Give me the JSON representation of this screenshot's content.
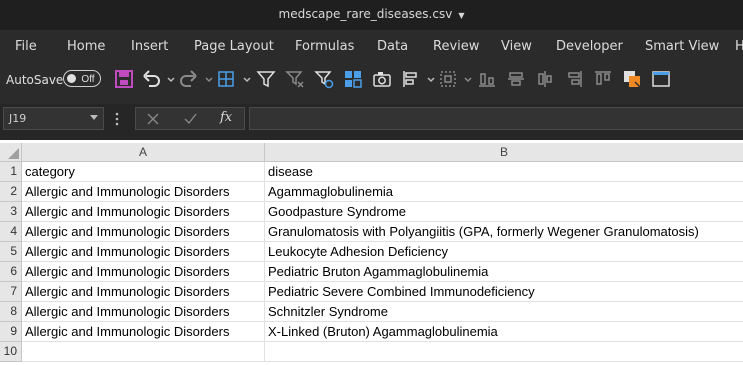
{
  "window": {
    "title": "medscape_rare_diseases.csv"
  },
  "menu": [
    "File",
    "Home",
    "Insert",
    "Page Layout",
    "Formulas",
    "Data",
    "Review",
    "View",
    "Developer",
    "Smart View",
    "H"
  ],
  "toolbar": {
    "autosave_label": "AutoSave",
    "toggle_label": "Off"
  },
  "formula_bar": {
    "name_box": "J19",
    "fx_label": "fx",
    "formula": ""
  },
  "sheet": {
    "columns": [
      "A",
      "B"
    ],
    "rows": [
      {
        "n": "1",
        "a": "category",
        "b": "disease"
      },
      {
        "n": "2",
        "a": "Allergic and Immunologic Disorders",
        "b": "Agammaglobulinemia"
      },
      {
        "n": "3",
        "a": "Allergic and Immunologic Disorders",
        "b": "Goodpasture Syndrome"
      },
      {
        "n": "4",
        "a": "Allergic and Immunologic Disorders",
        "b": "Granulomatosis with Polyangiitis (GPA, formerly Wegener Granulomatosis)"
      },
      {
        "n": "5",
        "a": "Allergic and Immunologic Disorders",
        "b": "Leukocyte Adhesion Deficiency"
      },
      {
        "n": "6",
        "a": "Allergic and Immunologic Disorders",
        "b": "Pediatric Bruton Agammaglobulinemia"
      },
      {
        "n": "7",
        "a": "Allergic and Immunologic Disorders",
        "b": "Pediatric Severe Combined Immunodeficiency"
      },
      {
        "n": "8",
        "a": "Allergic and Immunologic Disorders",
        "b": "Schnitzler Syndrome"
      },
      {
        "n": "9",
        "a": "Allergic and Immunologic Disorders",
        "b": "X-Linked (Bruton) Agammaglobulinemia"
      },
      {
        "n": "10",
        "a": "",
        "b": ""
      }
    ]
  }
}
